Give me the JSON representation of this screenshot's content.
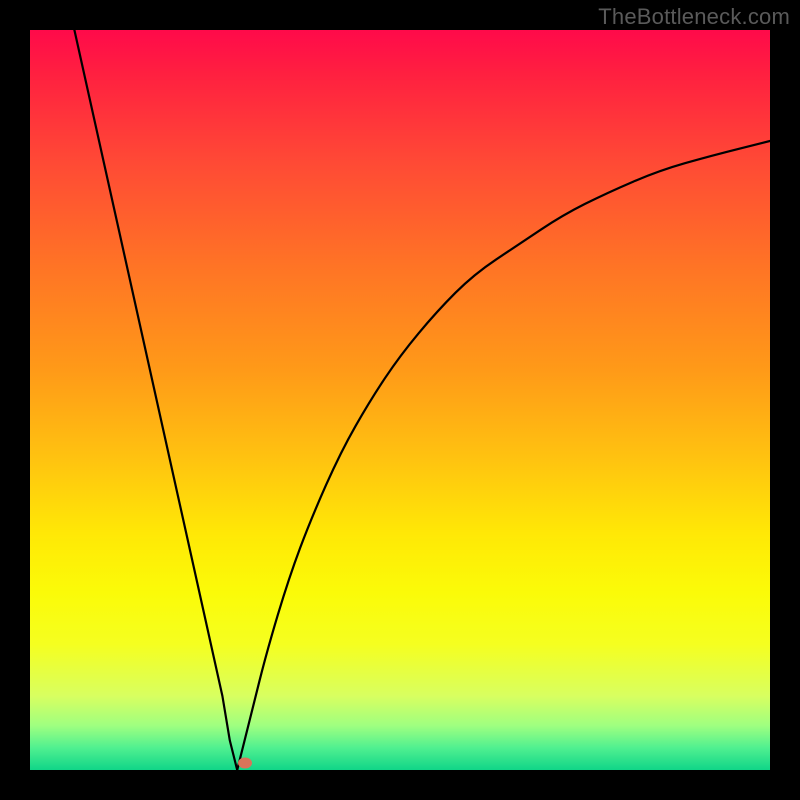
{
  "watermark": "TheBottleneck.com",
  "colors": {
    "frame": "#000000",
    "curve": "#000000",
    "marker": "#d9735a"
  },
  "chart_data": {
    "type": "line",
    "title": "",
    "xlabel": "",
    "ylabel": "",
    "xlim": [
      0,
      100
    ],
    "ylim": [
      0,
      100
    ],
    "grid": false,
    "legend": false,
    "series": [
      {
        "name": "left-branch",
        "x": [
          6,
          8,
          10,
          12,
          14,
          16,
          18,
          20,
          22,
          24,
          26,
          27,
          28
        ],
        "values": [
          100,
          91,
          82,
          73,
          64,
          55,
          46,
          37,
          28,
          19,
          10,
          4,
          0
        ]
      },
      {
        "name": "right-branch",
        "x": [
          28,
          30,
          32,
          35,
          38,
          42,
          46,
          50,
          55,
          60,
          66,
          72,
          78,
          85,
          92,
          100
        ],
        "values": [
          0,
          8,
          16,
          26,
          34,
          43,
          50,
          56,
          62,
          67,
          71,
          75,
          78,
          81,
          83,
          85
        ]
      }
    ],
    "marker": {
      "x": 29,
      "y": 1
    },
    "gradient_stops": [
      {
        "pos": 0.0,
        "color": "#ff0a4a"
      },
      {
        "pos": 0.18,
        "color": "#ff4a35"
      },
      {
        "pos": 0.46,
        "color": "#ff9a18"
      },
      {
        "pos": 0.68,
        "color": "#ffe806"
      },
      {
        "pos": 0.83,
        "color": "#f5ff20"
      },
      {
        "pos": 0.94,
        "color": "#9fff80"
      },
      {
        "pos": 1.0,
        "color": "#10d588"
      }
    ]
  }
}
